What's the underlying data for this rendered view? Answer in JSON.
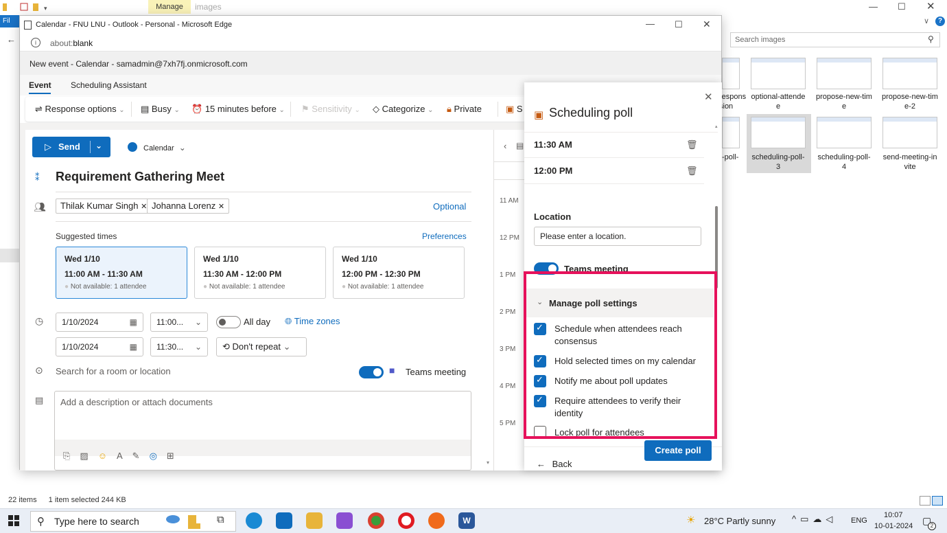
{
  "explorer": {
    "manage_tab": "Manage",
    "images_tab": "images",
    "file_tab": "Fil",
    "search_placeholder": "Search images",
    "status_items": "22 items",
    "status_selected": "1 item selected  244 KB",
    "thumbnails": [
      {
        "label_line1": "respons",
        "label_line2": "sion"
      },
      {
        "label_line1": "optional-attende",
        "label_line2": "e"
      },
      {
        "label_line1": "propose-new-tim",
        "label_line2": "e"
      },
      {
        "label_line1": "propose-new-tim",
        "label_line2": "e-2"
      },
      {
        "label_line1": "-poll-",
        "label_line2": ""
      },
      {
        "label_line1": "scheduling-poll-",
        "label_line2": "3"
      },
      {
        "label_line1": "scheduling-poll-",
        "label_line2": "4"
      },
      {
        "label_line1": "send-meeting-in",
        "label_line2": "vite"
      }
    ]
  },
  "edge": {
    "title": "Calendar - FNU LNU - Outlook - Personal - Microsoft Edge",
    "url_prefix": "about:",
    "url_path": "blank"
  },
  "outlook": {
    "header": "New event - Calendar - samadmin@7xh7fj.onmicrosoft.com",
    "tabs": [
      "Event",
      "Scheduling Assistant"
    ],
    "ribbon": {
      "response_options": "Response options",
      "busy": "Busy",
      "reminder": "15 minutes before",
      "sensitivity": "Sensitivity",
      "categorize": "Categorize",
      "private": "Private",
      "cut_label": "S"
    },
    "send": "Send",
    "calendar": "Calendar",
    "title": "Requirement Gathering Meet",
    "attendees": [
      "Thilak Kumar Singh",
      "Johanna Lorenz"
    ],
    "optional": "Optional",
    "suggested_times": "Suggested times",
    "preferences": "Preferences",
    "suggestions": [
      {
        "day": "Wed 1/10",
        "time": "11:00 AM - 11:30 AM",
        "note": "Not available: 1 attendee"
      },
      {
        "day": "Wed 1/10",
        "time": "11:30 AM - 12:00 PM",
        "note": "Not available: 1 attendee"
      },
      {
        "day": "Wed 1/10",
        "time": "12:00 PM - 12:30 PM",
        "note": "Not available: 1 attendee"
      }
    ],
    "start_date": "1/10/2024",
    "start_time": "11:00...",
    "all_day": "All day",
    "time_zones": "Time zones",
    "end_date": "1/10/2024",
    "end_time": "11:30...",
    "repeat": "Don't repeat",
    "location_placeholder": "Search for a room or location",
    "teams_meeting": "Teams meeting",
    "description_placeholder": "Add a description or attach documents",
    "hours": [
      "11 AM",
      "12 PM",
      "1 PM",
      "2 PM",
      "3 PM",
      "4 PM",
      "5 PM"
    ]
  },
  "poll": {
    "title": "Scheduling poll",
    "times": [
      "11:30 AM",
      "12:00 PM"
    ],
    "location_label": "Location",
    "location_placeholder": "Please enter a location.",
    "teams_meeting": "Teams meeting",
    "manage_settings": "Manage poll settings",
    "settings": [
      {
        "label": "Schedule when attendees reach consensus",
        "checked": true
      },
      {
        "label": "Hold selected times on my calendar",
        "checked": true
      },
      {
        "label": "Notify me about poll updates",
        "checked": true
      },
      {
        "label": "Require attendees to verify their identity",
        "checked": true
      },
      {
        "label": "Lock poll for attendees",
        "checked": false
      }
    ],
    "back": "Back",
    "create_poll": "Create poll"
  },
  "taskbar": {
    "search_placeholder": "Type here to search",
    "weather": "28°C  Partly sunny",
    "lang": "ENG",
    "time": "10:07",
    "date": "10-01-2024",
    "notification_count": "2"
  },
  "colors": {
    "accent": "#0f6cbd",
    "highlight": "#e6115b",
    "manage_tab": "#f9f2b8"
  }
}
